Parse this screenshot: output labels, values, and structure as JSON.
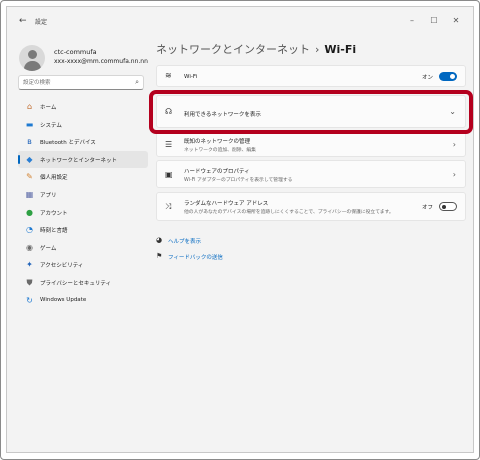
{
  "window": {
    "title": "設定",
    "controls": {
      "minimize": "–",
      "maximize": "☐",
      "close": "✕"
    }
  },
  "profile": {
    "name": "ctc-commufa",
    "email": "xxx-xxxx@mm.commufa.nn.nn"
  },
  "search": {
    "placeholder": "設定の検索"
  },
  "sidebar": {
    "items": [
      {
        "label": "ホーム",
        "icon": "home-icon",
        "glyph": "⌂",
        "color": "#c0692a"
      },
      {
        "label": "システム",
        "icon": "system-icon",
        "glyph": "▬",
        "color": "#1f7ad1"
      },
      {
        "label": "Bluetooth とデバイス",
        "icon": "bluetooth-icon",
        "glyph": "ʙ",
        "color": "#1f62b8"
      },
      {
        "label": "ネットワークとインターネット",
        "icon": "network-icon",
        "glyph": "◆",
        "color": "#2a7ed3",
        "selected": true
      },
      {
        "label": "個人用設定",
        "icon": "personalization-icon",
        "glyph": "✎",
        "color": "#d2812f"
      },
      {
        "label": "アプリ",
        "icon": "apps-icon",
        "glyph": "▦",
        "color": "#5d6ba8"
      },
      {
        "label": "アカウント",
        "icon": "accounts-icon",
        "glyph": "●",
        "color": "#2ea043"
      },
      {
        "label": "時刻と言語",
        "icon": "time-language-icon",
        "glyph": "◔",
        "color": "#1f7ad1"
      },
      {
        "label": "ゲーム",
        "icon": "gaming-icon",
        "glyph": "◉",
        "color": "#6b6b6b"
      },
      {
        "label": "アクセシビリティ",
        "icon": "accessibility-icon",
        "glyph": "✦",
        "color": "#1f62b8"
      },
      {
        "label": "プライバシーとセキュリティ",
        "icon": "privacy-shield-icon",
        "glyph": "⛊",
        "color": "#6b6b6b"
      },
      {
        "label": "Windows Update",
        "icon": "windows-update-icon",
        "glyph": "↻",
        "color": "#1f7ad1"
      }
    ]
  },
  "breadcrumb": {
    "parent": "ネットワークとインターネット",
    "separator": "›",
    "current": "Wi-Fi"
  },
  "cards": {
    "wifi": {
      "title": "Wi-Fi",
      "state": "オン",
      "toggle_on": true
    },
    "available_networks": {
      "title": "利用できるネットワークを表示"
    },
    "known_networks": {
      "title": "既知のネットワークの管理",
      "subtitle": "ネットワークの追加、削除、編集"
    },
    "hardware_properties": {
      "title": "ハードウェアのプロパティ",
      "subtitle": "Wi-Fi アダプターのプロパティを表示して管理する"
    },
    "random_hardware_address": {
      "title": "ランダムなハードウェア アドレス",
      "subtitle": "他の人があなたのデバイスの場所を追跡しにくくすることで、プライバシーの保護に役立てます。",
      "state": "オフ",
      "toggle_on": false
    }
  },
  "links": {
    "help": "ヘルプを表示",
    "feedback": "フィードバックの送信"
  },
  "colors": {
    "accent": "#0067c0",
    "highlight_border": "#b4001e",
    "background": "#f3f3f3"
  }
}
